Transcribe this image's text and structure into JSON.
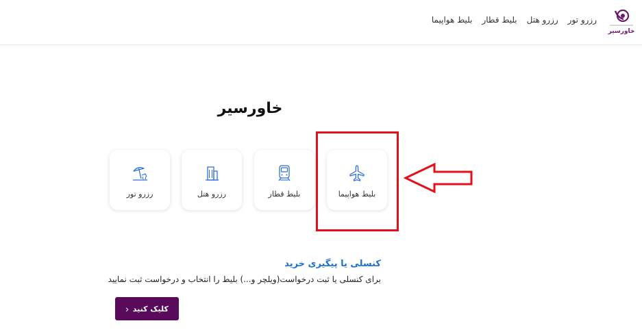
{
  "header": {
    "logo_icon": "khavarseir-logo-icon",
    "logo_text": "خاورسیر",
    "nav": [
      {
        "label": "بلیط هواپیما"
      },
      {
        "label": "بلیط قطار"
      },
      {
        "label": "رزرو هتل"
      },
      {
        "label": "رزرو تور"
      }
    ]
  },
  "main": {
    "title": "خاورسیر",
    "services": [
      {
        "label": "بلیط هواپیما",
        "icon": "airplane-icon"
      },
      {
        "label": "بلیط قطار",
        "icon": "train-icon"
      },
      {
        "label": "رزرو هتل",
        "icon": "hotel-building-icon"
      },
      {
        "label": "رزرو تور",
        "icon": "beach-umbrella-icon"
      }
    ],
    "cancel": {
      "title": "کنسلی یا پیگیری خرید",
      "description": "برای کنسلی یا ثبت درخواست(ویلچر و...) بلیط را انتخاب و درخواست ثبت نمایید",
      "button_label": "کلیک کنید"
    }
  },
  "colors": {
    "accent_blue": "#1a6fd8",
    "brand_purple": "#5a0a5a",
    "highlight_red": "#e3101b",
    "icon_blue": "#2f6fe0"
  }
}
